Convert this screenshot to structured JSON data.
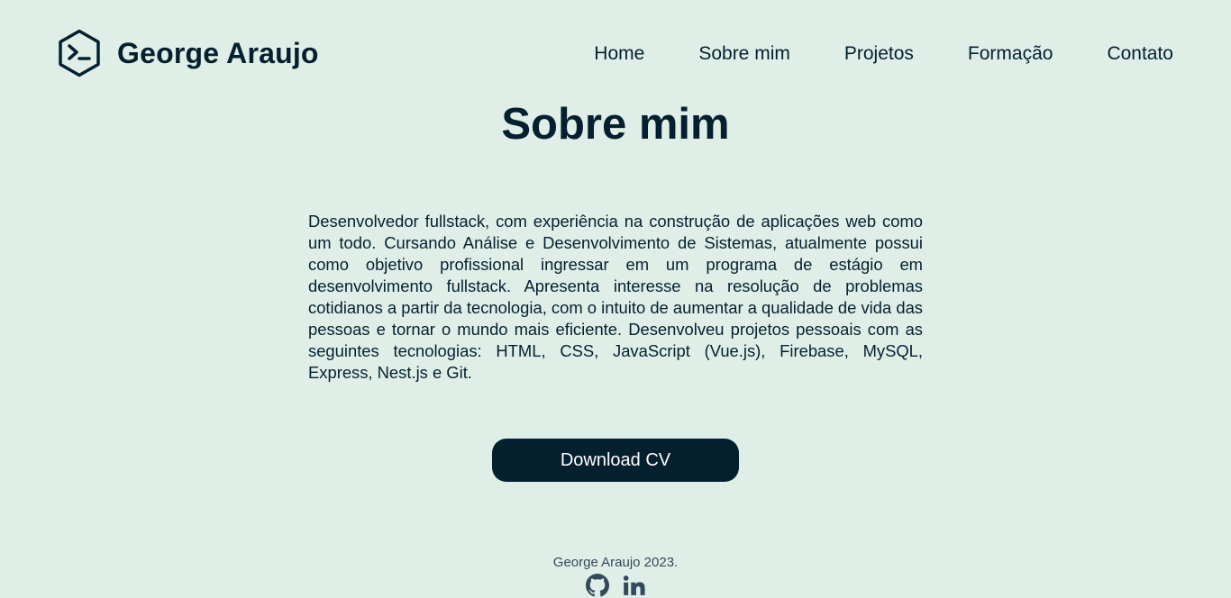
{
  "header": {
    "brand_name": "George Araujo",
    "logo_icon": "terminal-hexagon-icon",
    "nav": [
      {
        "label": "Home"
      },
      {
        "label": "Sobre mim"
      },
      {
        "label": "Projetos"
      },
      {
        "label": "Formação"
      },
      {
        "label": "Contato"
      }
    ]
  },
  "main": {
    "title": "Sobre mim",
    "about_text": "Desenvolvedor fullstack, com experiência na construção de aplicações web como um todo. Cursando Análise e Desenvolvimento de Sistemas, atualmente possui como objetivo profissional ingressar em um programa de estágio em desenvolvimento fullstack. Apresenta interesse na resolução de problemas cotidianos a partir da tecnologia, com o intuito de aumentar a qualidade de vida das pessoas e tornar o mundo mais eficiente. Desenvolveu projetos pessoais com as seguintes tecnologias: HTML, CSS, JavaScript (Vue.js), Firebase, MySQL, Express, Nest.js e Git.",
    "download_label": "Download CV"
  },
  "footer": {
    "copyright": "George Araujo 2023.",
    "social": [
      {
        "icon": "github-icon"
      },
      {
        "icon": "linkedin-icon"
      }
    ]
  },
  "colors": {
    "background": "#dfefe8",
    "primary": "#04202f",
    "button_text": "#ffffff",
    "footer_text": "#34495a"
  }
}
